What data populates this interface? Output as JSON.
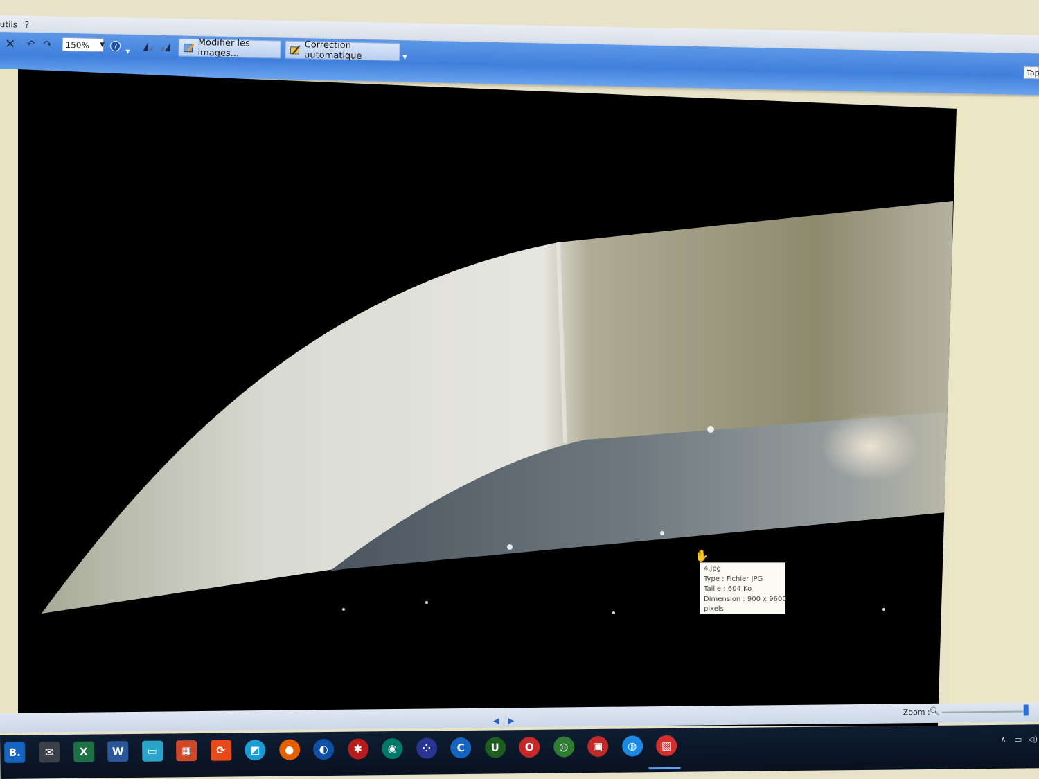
{
  "menu": {
    "items": [
      "utils",
      "?"
    ]
  },
  "toolbar": {
    "zoom_value": "150%",
    "modify_label": "Modifier les images...",
    "autocorrect_label": "Correction automatique",
    "tab_edge_label": "Tap"
  },
  "tooltip": {
    "line1": "4.jpg",
    "line2": "Type : Fichier JPG",
    "line3": "Taille : 604 Ko",
    "line4": "Dimension : 900 x 9600",
    "line5": "pixels"
  },
  "status": {
    "zoom_label": "Zoom :",
    "zoom_level": 0.98
  },
  "taskbar": {
    "start_label": "B.",
    "icons": [
      {
        "name": "mail-icon",
        "color": "#3a3f48",
        "glyph": "✉"
      },
      {
        "name": "excel-icon",
        "color": "#1e7145",
        "glyph": "X"
      },
      {
        "name": "word-icon",
        "color": "#2b579a",
        "glyph": "W"
      },
      {
        "name": "monitor-app-icon",
        "color": "#2aa5c9",
        "glyph": "▭"
      },
      {
        "name": "windows-tiles-icon",
        "color": "#d24726",
        "glyph": "▦"
      },
      {
        "name": "sync-app-icon",
        "color": "#e64a19",
        "glyph": "⟳"
      },
      {
        "name": "photo-app-icon",
        "color": "#1c9bd4",
        "glyph": "◩"
      },
      {
        "name": "firefox-icon",
        "color": "#e66000",
        "glyph": "●"
      },
      {
        "name": "teamviewer-icon",
        "color": "#0e4fa8",
        "glyph": "◐"
      },
      {
        "name": "red-app-icon",
        "color": "#b71c1c",
        "glyph": "✱"
      },
      {
        "name": "teal-app-icon",
        "color": "#00796b",
        "glyph": "◉"
      },
      {
        "name": "dots-app-icon",
        "color": "#283593",
        "glyph": "⁘"
      },
      {
        "name": "ccleaner-icon",
        "color": "#1565c0",
        "glyph": "C"
      },
      {
        "name": "utorrent-icon",
        "color": "#1b5e20",
        "glyph": "U"
      },
      {
        "name": "opera-icon",
        "color": "#c62828",
        "glyph": "O"
      },
      {
        "name": "chrome-icon",
        "color": "#2e7d32",
        "glyph": "◎"
      },
      {
        "name": "lock-app-icon",
        "color": "#c62828",
        "glyph": "▣"
      },
      {
        "name": "globe-app-icon",
        "color": "#1e88e5",
        "glyph": "◍"
      },
      {
        "name": "image-viewer-app-icon",
        "color": "#d32f2f",
        "glyph": "▧"
      }
    ]
  },
  "colors": {
    "toolbar_blue": "#3f80dc",
    "blade_light": "#dcdcd6",
    "panel_cream": "#ebe6c4"
  }
}
